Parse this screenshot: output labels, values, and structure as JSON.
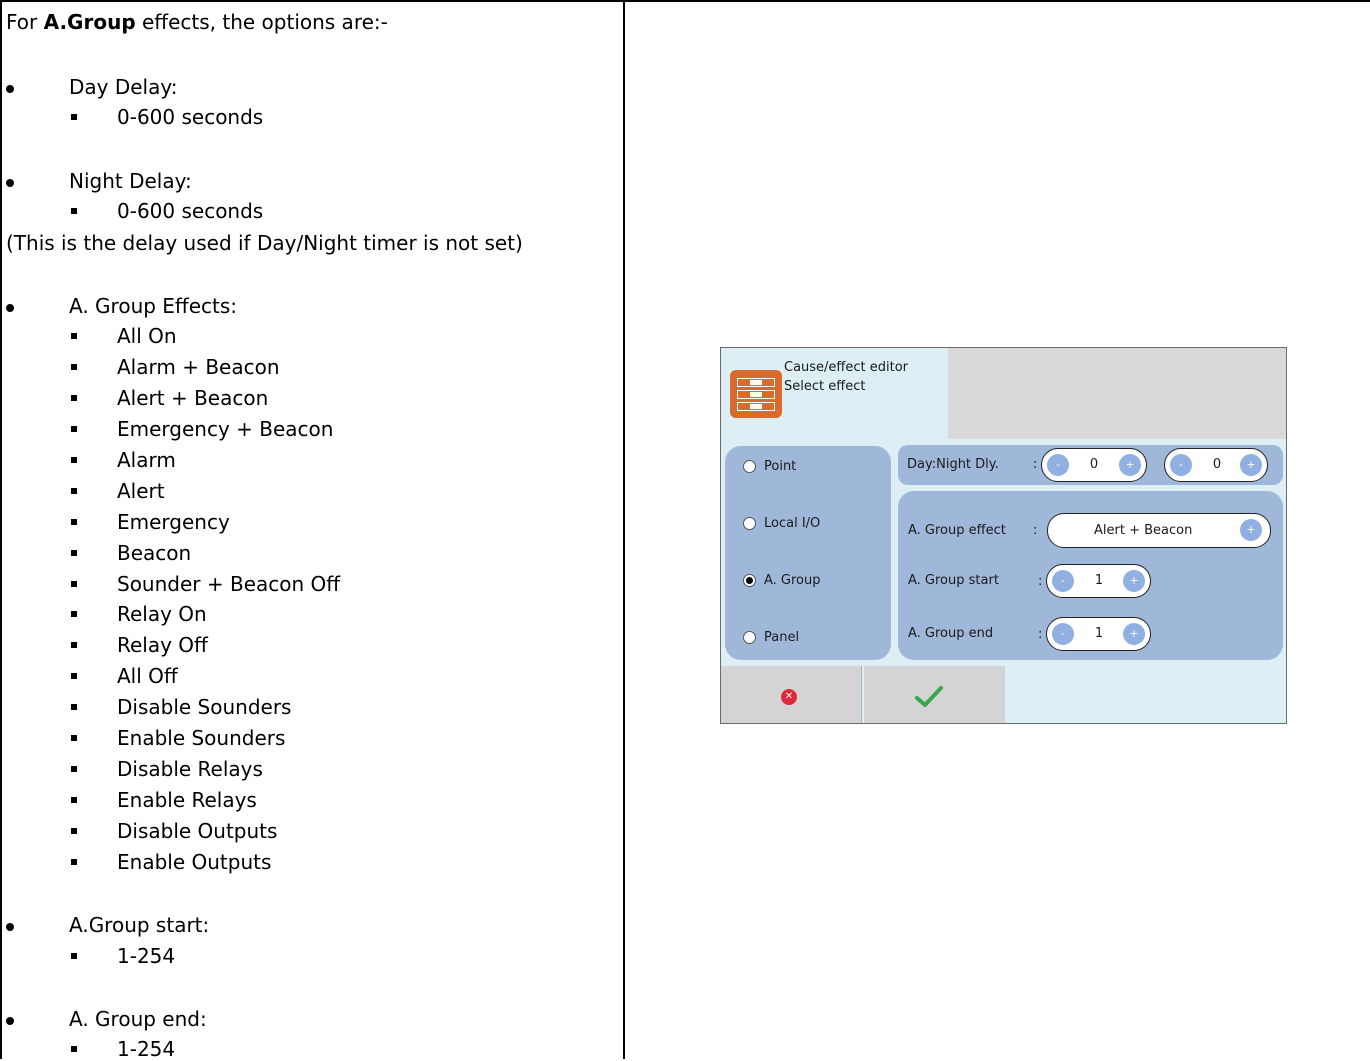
{
  "left": {
    "intro_prefix": "For ",
    "intro_bold": "A.Group",
    "intro_suffix": " effects, the options are:-",
    "day_delay": {
      "label": "Day Delay:",
      "value": "0-600 seconds"
    },
    "night_delay": {
      "label": "Night Delay:",
      "value": "0-600 seconds",
      "note": "(This is the delay used if Day/Night timer is not set)"
    },
    "group_effects": {
      "label": "A. Group Effects:",
      "items": [
        "All On",
        "Alarm + Beacon",
        "Alert + Beacon",
        "Emergency + Beacon",
        "Alarm",
        "Alert",
        "Emergency",
        "Beacon",
        "Sounder + Beacon Off",
        "Relay On",
        "Relay Off",
        "All Off",
        "Disable Sounders",
        "Enable Sounders",
        "Disable Relays",
        "Enable Relays",
        "Disable Outputs",
        "Enable Outputs"
      ]
    },
    "group_start": {
      "label": "A.Group start:",
      "value": "1-254"
    },
    "group_end": {
      "label": "A. Group end:",
      "value": "1-254"
    }
  },
  "device": {
    "title": "Cause/effect editor",
    "subtitle": "Select effect",
    "radios": [
      {
        "label": "Point",
        "selected": false
      },
      {
        "label": "Local I/O",
        "selected": false
      },
      {
        "label": "A. Group",
        "selected": true
      },
      {
        "label": "Panel",
        "selected": false
      }
    ],
    "day_night_label": "Day:Night Dly.",
    "colon": ":",
    "day_value": "0",
    "night_value": "0",
    "group_effect_label": "A. Group effect",
    "group_effect_value": "Alert + Beacon",
    "group_start_label": "A. Group start",
    "group_start_value": "1",
    "group_end_label": "A. Group end",
    "group_end_value": "1",
    "minus": "-",
    "plus": "+",
    "cancel_icon": "cancel-icon",
    "ok_icon": "checkmark-icon",
    "colors": {
      "background": "#ddeef4",
      "panel": "#9fb8d9",
      "button": "#8fb0e0",
      "logo": "#d86a2e",
      "cancel": "#e0283a",
      "ok": "#3aa64a"
    }
  }
}
